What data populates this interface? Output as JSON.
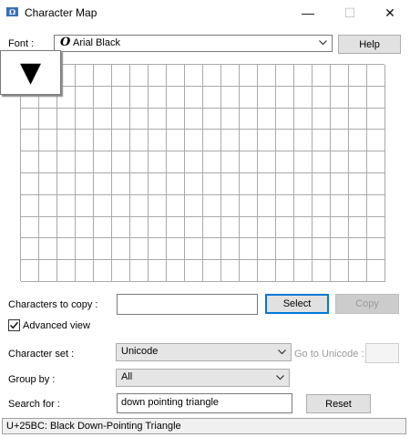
{
  "window": {
    "title": "Character Map",
    "minimize_glyph": "—",
    "maximize_glyph": "☐",
    "close_glyph": "✕"
  },
  "font_row": {
    "label": "Font :",
    "font_icon_glyph": "O",
    "selected_font": "Arial Black",
    "help_label": "Help"
  },
  "character_grid": {
    "columns": 20,
    "rows": 10,
    "selected_character": "▼"
  },
  "copy_row": {
    "label": "Characters to copy :",
    "value": "",
    "select_label": "Select",
    "copy_label": "Copy"
  },
  "advanced_view": {
    "label": "Advanced view",
    "checked": true
  },
  "character_set": {
    "label": "Character set :",
    "value": "Unicode"
  },
  "go_to_unicode": {
    "label": "Go to Unicode :",
    "value": ""
  },
  "group_by": {
    "label": "Group by :",
    "value": "All"
  },
  "search": {
    "label": "Search for :",
    "value": "down pointing triangle",
    "reset_label": "Reset"
  },
  "status": {
    "text": "U+25BC: Black Down-Pointing Triangle"
  },
  "colors": {
    "accent": "#0078d7",
    "grid_line": "#aaaaaa",
    "disabled_text": "#9a9a9a"
  }
}
